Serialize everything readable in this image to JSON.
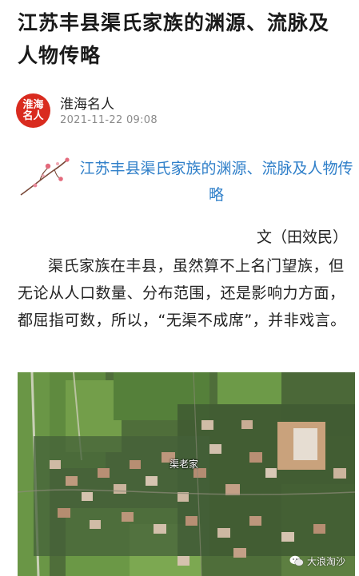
{
  "article": {
    "title": "江苏丰县渠氏家族的渊源、流脉及人物传略",
    "subheading": "江苏丰县渠氏家族的渊源、流脉及人物传略",
    "byline": "文（田效民）",
    "paragraph": "渠氏家族在丰县，虽然算不上名门望族，但无论从人口数量、分布范围，还是影响力方面，都屈指可数，所以，“无渠不成席”，并非戏言。"
  },
  "account": {
    "avatar_line1": "淮海",
    "avatar_line2": "名人",
    "name": "淮海名人",
    "date": "2021-11-22 09:08"
  },
  "image": {
    "map_label": "渠老家",
    "watermark": "大浪淘沙"
  },
  "colors": {
    "accent": "#2f7fc9",
    "avatar": "#d92b1f"
  }
}
